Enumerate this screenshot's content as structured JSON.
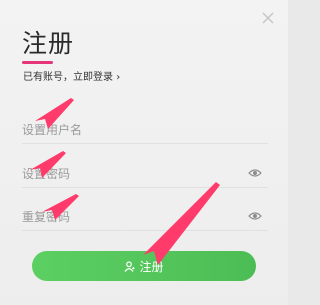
{
  "dialog": {
    "title": "注册",
    "login_link": "已有账号，立即登录",
    "login_chevron": "›"
  },
  "fields": {
    "username_placeholder": "设置用户名",
    "password_placeholder": "设置密码",
    "confirm_placeholder": "重复密码"
  },
  "button": {
    "label": "注册",
    "icon": "user-icon"
  },
  "icons": {
    "close": "close-icon",
    "eye": "eye-icon"
  },
  "colors": {
    "accent_underline": "#e6367a",
    "button_green": "#56c85c",
    "annotation_arrow": "#ff3b6b"
  }
}
